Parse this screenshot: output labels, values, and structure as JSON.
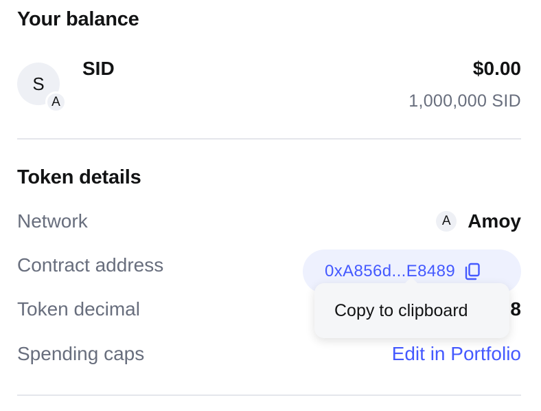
{
  "balance": {
    "heading": "Your balance",
    "token_avatar_letter": "S",
    "network_badge_letter": "A",
    "token_name": "SID",
    "fiat_value": "$0.00",
    "token_amount": "1,000,000 SID"
  },
  "details": {
    "heading": "Token details",
    "network_label": "Network",
    "network_icon_letter": "A",
    "network_name": "Amoy",
    "contract_label": "Contract address",
    "contract_address": "0xA856d...E8489",
    "decimal_label": "Token decimal",
    "decimal_value": "8",
    "caps_label": "Spending caps",
    "caps_link": "Edit in Portfolio"
  },
  "tooltip": {
    "text": "Copy to clipboard"
  },
  "colors": {
    "accent": "#4459ff",
    "muted_text": "#686e7d",
    "pill_bg": "#eef1fe"
  }
}
